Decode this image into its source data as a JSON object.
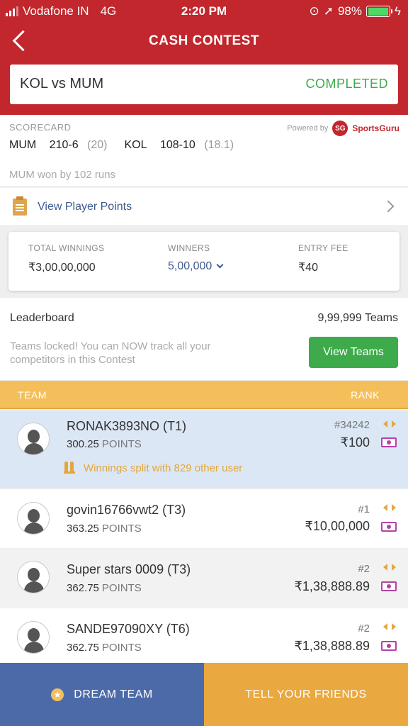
{
  "status_bar": {
    "carrier": "Vodafone IN",
    "network": "4G",
    "time": "2:20 PM",
    "battery": "98%",
    "battery_level": 0.98
  },
  "header": {
    "title": "CASH CONTEST",
    "match": "KOL vs MUM",
    "match_status": "COMPLETED"
  },
  "scorecard": {
    "label": "SCORECARD",
    "powered_by": "Powered by",
    "provider_logo": "SG",
    "provider": "SportsGuru",
    "teams": [
      {
        "team": "MUM",
        "runs": "210-6",
        "overs": "(20)"
      },
      {
        "team": "KOL",
        "runs": "108-10",
        "overs": "(18.1)"
      }
    ],
    "result": "MUM won by 102 runs"
  },
  "player_points": {
    "label": "View Player Points"
  },
  "stats": {
    "total_winnings_label": "TOTAL WINNINGS",
    "total_winnings": "₹3,00,00,000",
    "winners_label": "WINNERS",
    "winners": "5,00,000",
    "entry_fee_label": "ENTRY FEE",
    "entry_fee": "₹40"
  },
  "leaderboard": {
    "title": "Leaderboard",
    "team_count": "9,99,999 Teams",
    "note": "Teams locked! You can NOW track all your competitors in this Contest",
    "view_teams_label": "View Teams"
  },
  "table": {
    "team_header": "TEAM",
    "rank_header": "RANK",
    "points_suffix": "POINTS",
    "rows": [
      {
        "name": "RONAK3893NO (T1)",
        "points": "300.25",
        "rank": "#34242",
        "amount": "₹100",
        "split": "Winnings split with 829 other user"
      },
      {
        "name": "govin16766vwt2 (T3)",
        "points": "363.25",
        "rank": "#1",
        "amount": "₹10,00,000"
      },
      {
        "name": "Super stars 0009 (T3)",
        "points": "362.75",
        "rank": "#2",
        "amount": "₹1,38,888.89"
      },
      {
        "name": "SANDE97090XY (T6)",
        "points": "362.75",
        "rank": "#2",
        "amount": "₹1,38,888.89"
      }
    ]
  },
  "bottom": {
    "dream_team_label": "DREAM TEAM",
    "tell_friends_label": "TELL YOUR FRIENDS"
  },
  "colors": {
    "header_red": "#c1272d",
    "completed_green": "#3dab4b",
    "link_blue": "#3e5a8e",
    "rank_header_yellow": "#f4bf5b",
    "highlight_row": "#dce7f6",
    "dream_team_blue": "#4d6aa8",
    "tell_friends_orange": "#e9a840"
  }
}
